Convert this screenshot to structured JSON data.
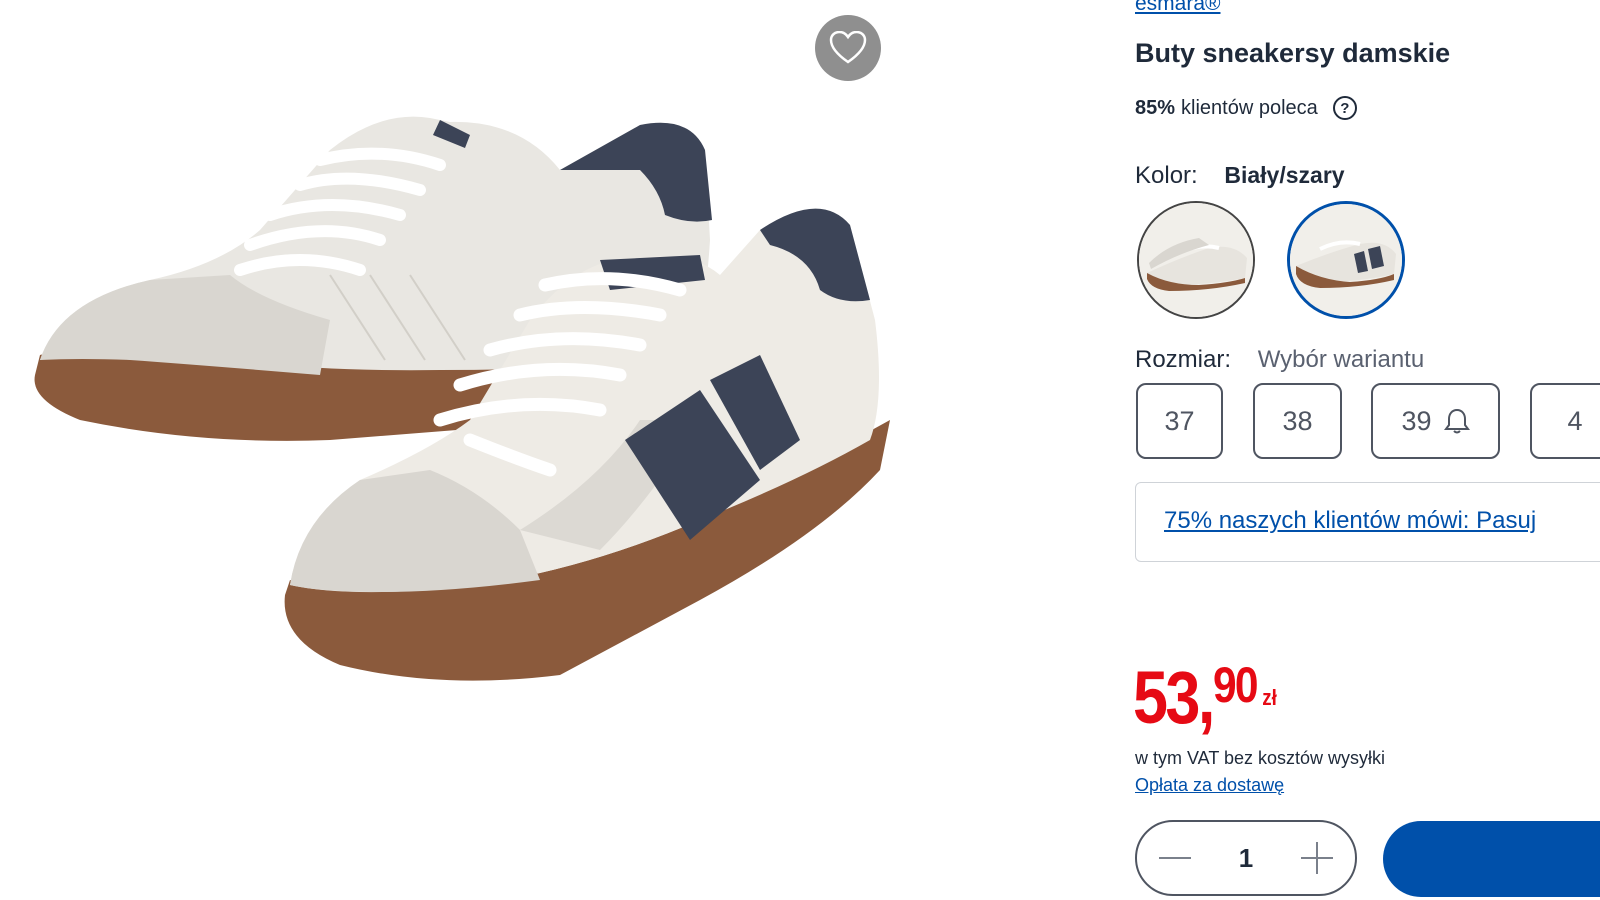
{
  "product": {
    "brand": "esmara®",
    "title": "Buty sneakersy damskie",
    "recommend_percent": "85%",
    "recommend_text": "klientów poleca",
    "help_symbol": "?"
  },
  "color": {
    "label": "Kolor:",
    "selected": "Biały/szary",
    "swatches": [
      "white-sneaker-swatch",
      "grey-striped-sneaker-swatch"
    ],
    "selected_index": 1
  },
  "size": {
    "label": "Rozmiar:",
    "hint": "Wybór wariantu",
    "options": [
      "37",
      "38",
      "39",
      "4"
    ],
    "notify_icon_on": "39"
  },
  "fit": {
    "link_text": "75% naszych klientów mówi: Pasuj"
  },
  "price": {
    "main": "53,",
    "cents": "90",
    "currency": "zł",
    "vat_text": "w tym VAT bez kosztów wysyłki",
    "delivery_link": "Opłata za dostawę"
  },
  "quantity": {
    "value": "1"
  },
  "icons": {
    "favorite": "heart-icon",
    "help": "question-icon",
    "notify": "bell-icon",
    "minus": "minus-icon",
    "plus": "plus-icon"
  },
  "colors": {
    "brand_blue": "#0050aa",
    "price_red": "#e60a14",
    "text_dark": "#1f2a3a"
  }
}
